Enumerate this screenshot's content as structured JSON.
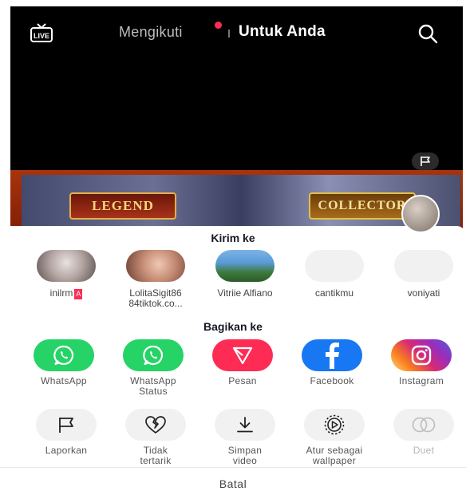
{
  "topbar": {
    "live_label": "LIVE",
    "tab_following": "Mengikuti",
    "tab_for_you": "Untuk Anda"
  },
  "banner": {
    "left_badge": "LEGEND",
    "right_badge": "COLLECTOR"
  },
  "send_to": {
    "title": "Kirim ke",
    "contacts": [
      {
        "name": "inilrm",
        "tag": "A"
      },
      {
        "name": "LolitaSigit86",
        "name_line2": "84tiktok.co..."
      },
      {
        "name": "Vitriie Alfiano"
      },
      {
        "name": "cantikmu"
      },
      {
        "name": "voniyati"
      }
    ]
  },
  "share_to": {
    "title": "Bagikan ke",
    "apps": [
      {
        "label": "WhatsApp",
        "color": "#25d366",
        "icon": "whatsapp-icon"
      },
      {
        "label": "WhatsApp",
        "label_line2": "Status",
        "color": "#25d366",
        "icon": "whatsapp-icon"
      },
      {
        "label": "Pesan",
        "color": "#fe2c55",
        "icon": "send-icon"
      },
      {
        "label": "Facebook",
        "color": "#1877f2",
        "icon": "facebook-icon"
      },
      {
        "label": "Instagram",
        "color": "#d62976",
        "icon": "instagram-icon"
      }
    ]
  },
  "actions": [
    {
      "label": "Laporkan",
      "icon": "flag-icon"
    },
    {
      "label": "Tidak",
      "label_line2": "tertarik",
      "icon": "broken-heart-icon"
    },
    {
      "label": "Simpan",
      "label_line2": "video",
      "icon": "download-icon"
    },
    {
      "label": "Atur sebagai",
      "label_line2": "wallpaper",
      "icon": "live-photo-icon"
    },
    {
      "label": "Duet",
      "icon": "duet-icon"
    }
  ],
  "cancel_label": "Batal"
}
